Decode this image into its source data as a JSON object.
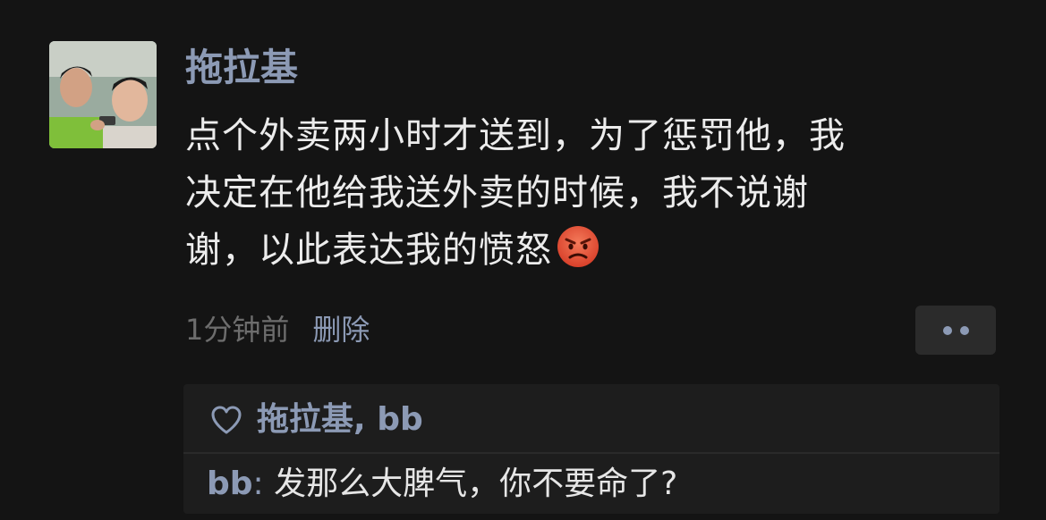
{
  "post": {
    "username": "拖拉基",
    "text_lines": [
      "点个外卖两小时才送到，为了惩罚他，我",
      "决定在他给我送外卖的时候，我不说谢",
      "谢，以此表达我的愤怒"
    ],
    "emoji": "angry-face-emoji",
    "time": "1分钟前",
    "delete_label": "删除",
    "more_icon": "more-dots-icon"
  },
  "likes": {
    "icon": "heart-icon",
    "names": "拖拉基, bb"
  },
  "comments": [
    {
      "author": "bb",
      "separator": ":",
      "text": " 发那么大脾气，你不要命了?"
    }
  ],
  "colors": {
    "background": "#141414",
    "link_blue": "#8c9ab5",
    "text": "#ececec",
    "muted": "#6d6d6d",
    "panel": "#1d1d1d",
    "emoji_red": "#e8553e"
  }
}
